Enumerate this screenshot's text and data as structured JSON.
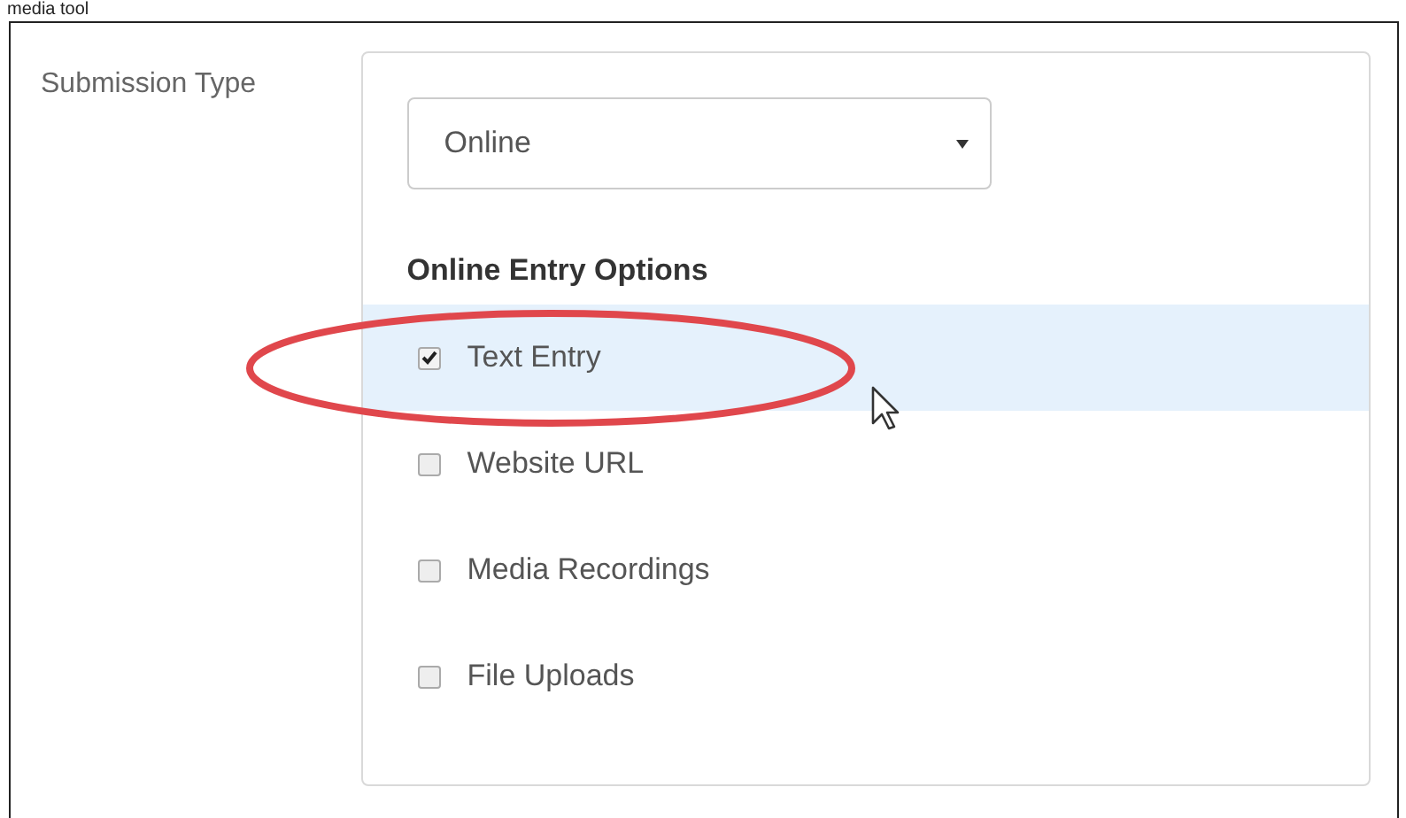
{
  "caption": "media tool",
  "form": {
    "label": "Submission Type",
    "select": {
      "value": "Online"
    },
    "section_title": "Online Entry Options",
    "options": [
      {
        "label": "Text Entry",
        "checked": true,
        "highlighted": true
      },
      {
        "label": "Website URL",
        "checked": false,
        "highlighted": false
      },
      {
        "label": "Media Recordings",
        "checked": false,
        "highlighted": false
      },
      {
        "label": "File Uploads",
        "checked": false,
        "highlighted": false
      }
    ]
  }
}
